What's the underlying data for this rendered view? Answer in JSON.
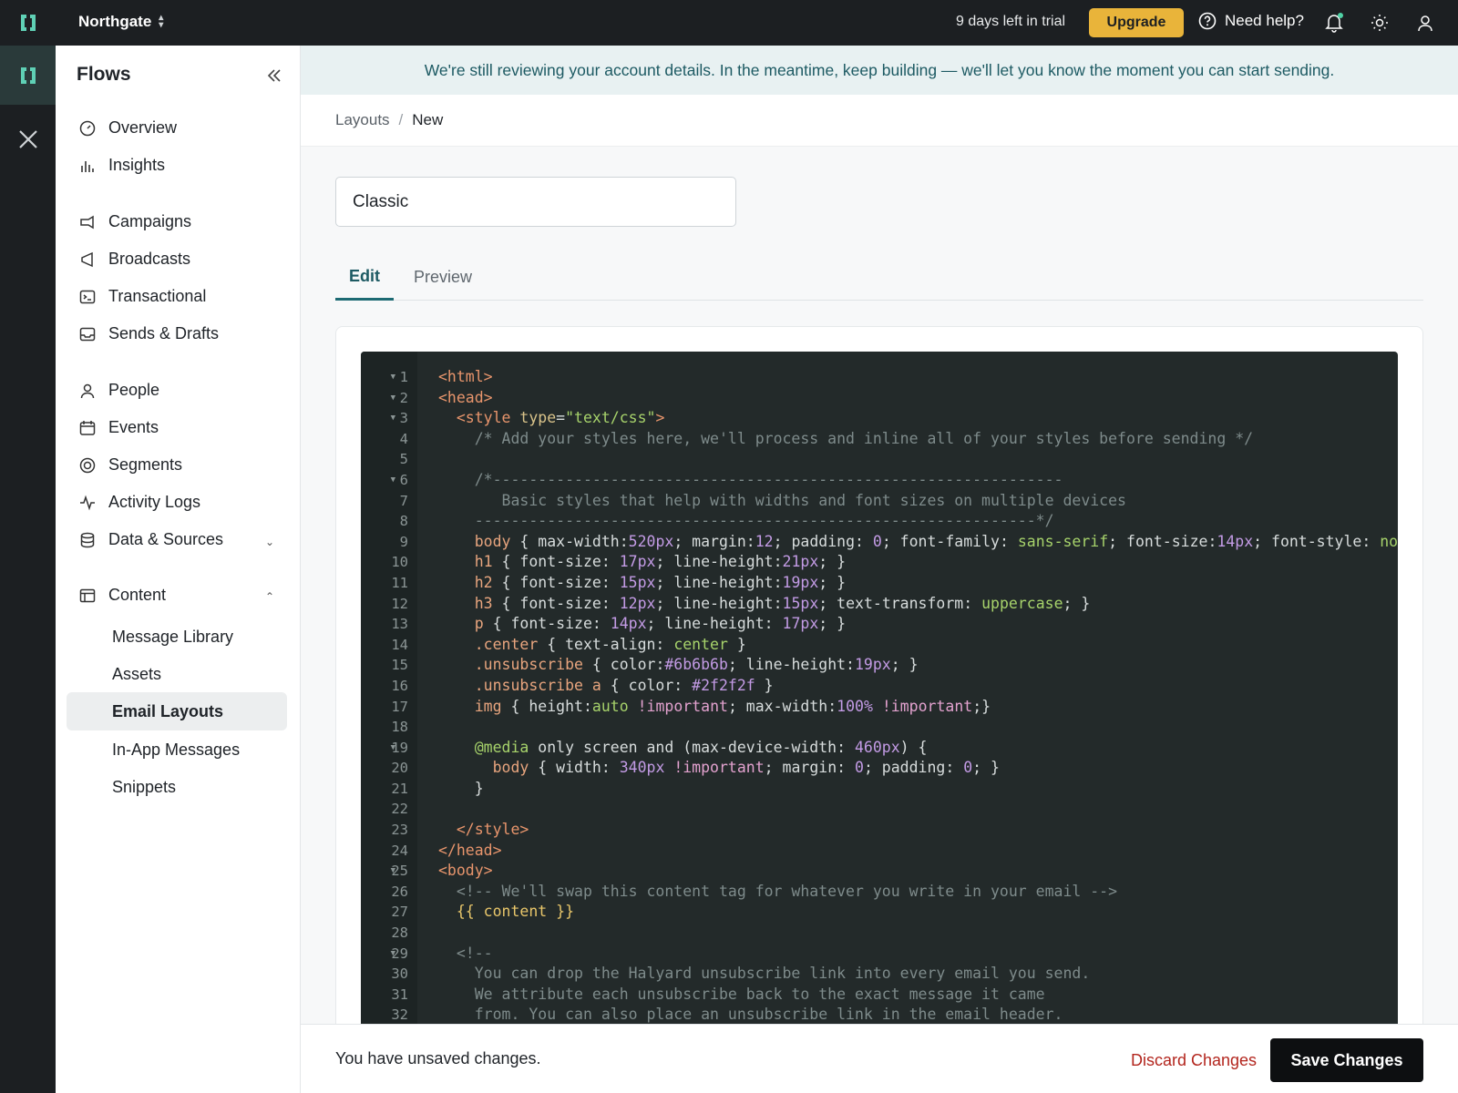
{
  "topbar": {
    "workspace": "Northgate",
    "trial_text": "9 days left in trial",
    "upgrade_label": "Upgrade",
    "help_label": "Need help?"
  },
  "sidebar": {
    "title": "Flows",
    "items": [
      {
        "label": "Overview",
        "icon": "overview-icon"
      },
      {
        "label": "Insights",
        "icon": "chart-icon"
      },
      {
        "label": "Campaigns",
        "icon": "campaign-icon"
      },
      {
        "label": "Broadcasts",
        "icon": "megaphone-icon"
      },
      {
        "label": "Transactional",
        "icon": "terminal-icon"
      },
      {
        "label": "Sends & Drafts",
        "icon": "inbox-icon"
      },
      {
        "label": "People",
        "icon": "person-icon"
      },
      {
        "label": "Events",
        "icon": "calendar-icon"
      },
      {
        "label": "Segments",
        "icon": "target-icon"
      },
      {
        "label": "Activity Logs",
        "icon": "activity-icon"
      },
      {
        "label": "Data & Sources",
        "icon": "database-icon"
      },
      {
        "label": "Content",
        "icon": "layout-icon"
      }
    ],
    "content_sub": [
      {
        "label": "Message Library"
      },
      {
        "label": "Assets"
      },
      {
        "label": "Email Layouts"
      },
      {
        "label": "In-App Messages"
      },
      {
        "label": "Snippets"
      }
    ]
  },
  "banner": {
    "text": "We're still reviewing your account details. In the meantime, keep building — we'll let you know the moment you can start sending."
  },
  "breadcrumb": {
    "parent": "Layouts",
    "separator": "/",
    "current": "New"
  },
  "layout_name": {
    "value": "Classic"
  },
  "tabs": [
    {
      "label": "Edit"
    },
    {
      "label": "Preview"
    }
  ],
  "editor": {
    "folds": [
      1,
      2,
      3,
      6,
      19,
      25,
      29
    ],
    "lines": [
      [
        [
          "t",
          "<html>"
        ]
      ],
      [
        [
          "t",
          "<head>"
        ]
      ],
      [
        [
          "x",
          "  "
        ],
        [
          "t",
          "<style "
        ],
        [
          "a",
          "type"
        ],
        [
          "x",
          "="
        ],
        [
          "s",
          "\"text/css\""
        ],
        [
          "t",
          ">"
        ]
      ],
      [
        [
          "x",
          "    "
        ],
        [
          "c",
          "/* Add your styles here, we'll process and inline all of your styles before sending */"
        ]
      ],
      [],
      [
        [
          "x",
          "    "
        ],
        [
          "c",
          "/*---------------------------------------------------------------"
        ]
      ],
      [
        [
          "x",
          "    "
        ],
        [
          "c",
          "   Basic styles that help with widths and font sizes on multiple devices"
        ]
      ],
      [
        [
          "x",
          "    "
        ],
        [
          "c",
          "--------------------------------------------------------------*/"
        ]
      ],
      [
        [
          "x",
          "    "
        ],
        [
          "k",
          "body"
        ],
        [
          "x",
          " { max-width:"
        ],
        [
          "v",
          "520px"
        ],
        [
          "x",
          "; margin:"
        ],
        [
          "v",
          "12"
        ],
        [
          "x",
          "; padding: "
        ],
        [
          "v",
          "0"
        ],
        [
          "x",
          "; font-family: "
        ],
        [
          "s",
          "sans-serif"
        ],
        [
          "x",
          "; font-size:"
        ],
        [
          "v",
          "14px"
        ],
        [
          "x",
          "; font-style: "
        ],
        [
          "s",
          "normal"
        ],
        [
          "x",
          "; }"
        ]
      ],
      [
        [
          "x",
          "    "
        ],
        [
          "k",
          "h1"
        ],
        [
          "x",
          " { font-size: "
        ],
        [
          "v",
          "17px"
        ],
        [
          "x",
          "; line-height:"
        ],
        [
          "v",
          "21px"
        ],
        [
          "x",
          "; }"
        ]
      ],
      [
        [
          "x",
          "    "
        ],
        [
          "k",
          "h2"
        ],
        [
          "x",
          " { font-size: "
        ],
        [
          "v",
          "15px"
        ],
        [
          "x",
          "; line-height:"
        ],
        [
          "v",
          "19px"
        ],
        [
          "x",
          "; }"
        ]
      ],
      [
        [
          "x",
          "    "
        ],
        [
          "k",
          "h3"
        ],
        [
          "x",
          " { font-size: "
        ],
        [
          "v",
          "12px"
        ],
        [
          "x",
          "; line-height:"
        ],
        [
          "v",
          "15px"
        ],
        [
          "x",
          "; text-transform: "
        ],
        [
          "s",
          "uppercase"
        ],
        [
          "x",
          "; }"
        ]
      ],
      [
        [
          "x",
          "    "
        ],
        [
          "k",
          "p"
        ],
        [
          "x",
          " { font-size: "
        ],
        [
          "v",
          "14px"
        ],
        [
          "x",
          "; line-height: "
        ],
        [
          "v",
          "17px"
        ],
        [
          "x",
          "; }"
        ]
      ],
      [
        [
          "x",
          "    "
        ],
        [
          "k",
          ".center"
        ],
        [
          "x",
          " { text-align: "
        ],
        [
          "s",
          "center"
        ],
        [
          "x",
          " }"
        ]
      ],
      [
        [
          "x",
          "    "
        ],
        [
          "k",
          ".unsubscribe"
        ],
        [
          "x",
          " { color:"
        ],
        [
          "v",
          "#6b6b6b"
        ],
        [
          "x",
          "; line-height:"
        ],
        [
          "v",
          "19px"
        ],
        [
          "x",
          "; }"
        ]
      ],
      [
        [
          "x",
          "    "
        ],
        [
          "k",
          ".unsubscribe a"
        ],
        [
          "x",
          " { color: "
        ],
        [
          "v",
          "#2f2f2f"
        ],
        [
          "x",
          " }"
        ]
      ],
      [
        [
          "x",
          "    "
        ],
        [
          "k",
          "img"
        ],
        [
          "x",
          " { height:"
        ],
        [
          "s",
          "auto"
        ],
        [
          "x",
          " "
        ],
        [
          "m",
          "!important"
        ],
        [
          "x",
          "; max-width:"
        ],
        [
          "v",
          "100%"
        ],
        [
          "x",
          " "
        ],
        [
          "m",
          "!important"
        ],
        [
          "x",
          ";}"
        ]
      ],
      [],
      [
        [
          "x",
          "    "
        ],
        [
          "s",
          "@media"
        ],
        [
          "x",
          " only screen and (max-device-width: "
        ],
        [
          "v",
          "460px"
        ],
        [
          "x",
          ") {"
        ]
      ],
      [
        [
          "x",
          "      "
        ],
        [
          "k",
          "body"
        ],
        [
          "x",
          " { width: "
        ],
        [
          "v",
          "340px"
        ],
        [
          "x",
          " "
        ],
        [
          "m",
          "!important"
        ],
        [
          "x",
          "; margin: "
        ],
        [
          "v",
          "0"
        ],
        [
          "x",
          "; padding: "
        ],
        [
          "v",
          "0"
        ],
        [
          "x",
          "; }"
        ]
      ],
      [
        [
          "x",
          "    }"
        ]
      ],
      [],
      [
        [
          "x",
          "  "
        ],
        [
          "t",
          "</style>"
        ]
      ],
      [
        [
          "t",
          "</head>"
        ]
      ],
      [
        [
          "t",
          "<body>"
        ]
      ],
      [
        [
          "x",
          "  "
        ],
        [
          "c",
          "<!-- We'll swap this content tag for whatever you write in your email -->"
        ]
      ],
      [
        [
          "x",
          "  "
        ],
        [
          "p",
          "{{ content }}"
        ]
      ],
      [],
      [
        [
          "x",
          "  "
        ],
        [
          "c",
          "<!--"
        ]
      ],
      [
        [
          "x",
          "    "
        ],
        [
          "c",
          "You can drop the Halyard unsubscribe link into every email you send."
        ]
      ],
      [
        [
          "x",
          "    "
        ],
        [
          "c",
          "We attribute each unsubscribe back to the exact message it came"
        ]
      ],
      [
        [
          "x",
          "    "
        ],
        [
          "c",
          "from. You can also place an unsubscribe link in the email header."
        ]
      ]
    ]
  },
  "footer": {
    "message": "You have unsaved changes.",
    "discard_label": "Discard Changes",
    "save_label": "Save Changes"
  }
}
